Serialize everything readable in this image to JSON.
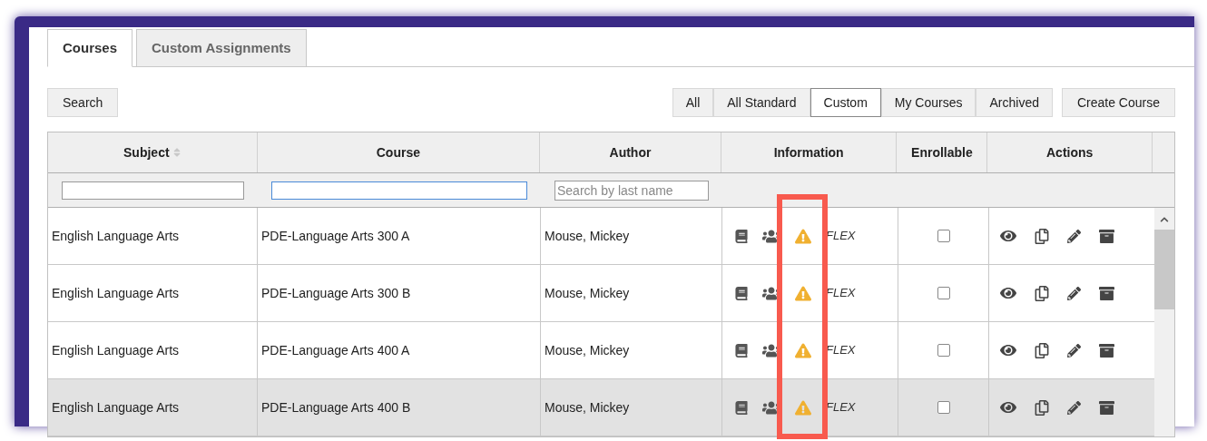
{
  "tabs": [
    {
      "label": "Courses",
      "selected": true
    },
    {
      "label": "Custom Assignments",
      "selected": false
    }
  ],
  "search_button": "Search",
  "filters": [
    {
      "label": "All",
      "selected": false
    },
    {
      "label": "All Standard",
      "selected": false
    },
    {
      "label": "Custom",
      "selected": true
    },
    {
      "label": "My Courses",
      "selected": false
    },
    {
      "label": "Archived",
      "selected": false
    }
  ],
  "create_button": "Create Course",
  "table": {
    "columns": [
      {
        "label": "Subject",
        "sorted": true
      },
      {
        "label": "Course",
        "sorted": false
      },
      {
        "label": "Author",
        "sorted": false
      },
      {
        "label": "Information",
        "sorted": false
      },
      {
        "label": "Enrollable",
        "sorted": false
      },
      {
        "label": "Actions",
        "sorted": false
      }
    ],
    "author_filter_placeholder": "Search by last name",
    "rows": [
      {
        "subject": "English Language Arts",
        "course": "PDE-Language Arts 300 A",
        "author": "Mouse, Mickey",
        "type": "FLEX",
        "enrollable": false,
        "selected": false
      },
      {
        "subject": "English Language Arts",
        "course": "PDE-Language Arts 300 B",
        "author": "Mouse, Mickey",
        "type": "FLEX",
        "enrollable": false,
        "selected": false
      },
      {
        "subject": "English Language Arts",
        "course": "PDE-Language Arts 400 A",
        "author": "Mouse, Mickey",
        "type": "FLEX",
        "enrollable": false,
        "selected": false
      },
      {
        "subject": "English Language Arts",
        "course": "PDE-Language Arts 400 B",
        "author": "Mouse, Mickey",
        "type": "FLEX",
        "enrollable": false,
        "selected": true
      }
    ]
  }
}
